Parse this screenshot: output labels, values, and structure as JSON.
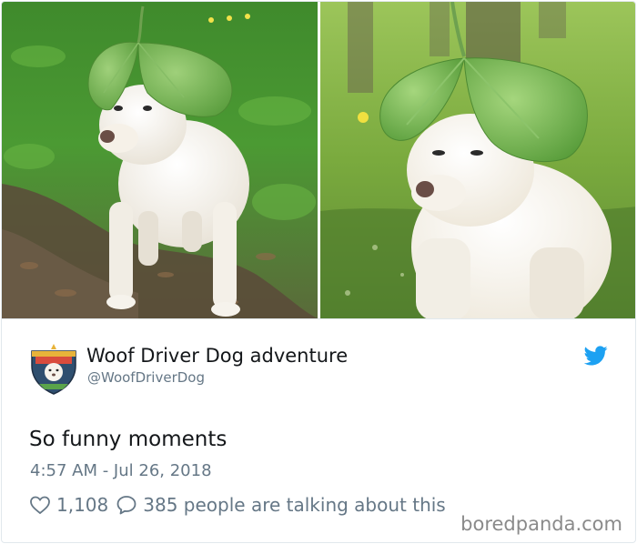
{
  "tweet": {
    "display_name": "Woof Driver Dog adventure",
    "handle": "@WoofDriverDog",
    "text": "So funny moments",
    "timestamp": "4:57 AM - Jul 26, 2018",
    "likes": "1,108",
    "talking": "385 people are talking about this"
  },
  "media": [
    {
      "icon": "dog-with-leaf-hat-photo"
    },
    {
      "icon": "dog-with-leaf-hat-closeup-photo"
    }
  ],
  "icons": {
    "bird": "twitter-bird-icon",
    "like": "heart-icon",
    "reply": "speech-bubble-icon"
  },
  "colors": {
    "twitter_blue": "#1da1f2",
    "text_primary": "#14171a",
    "text_secondary": "#657786"
  },
  "watermark": "boredpanda.com"
}
